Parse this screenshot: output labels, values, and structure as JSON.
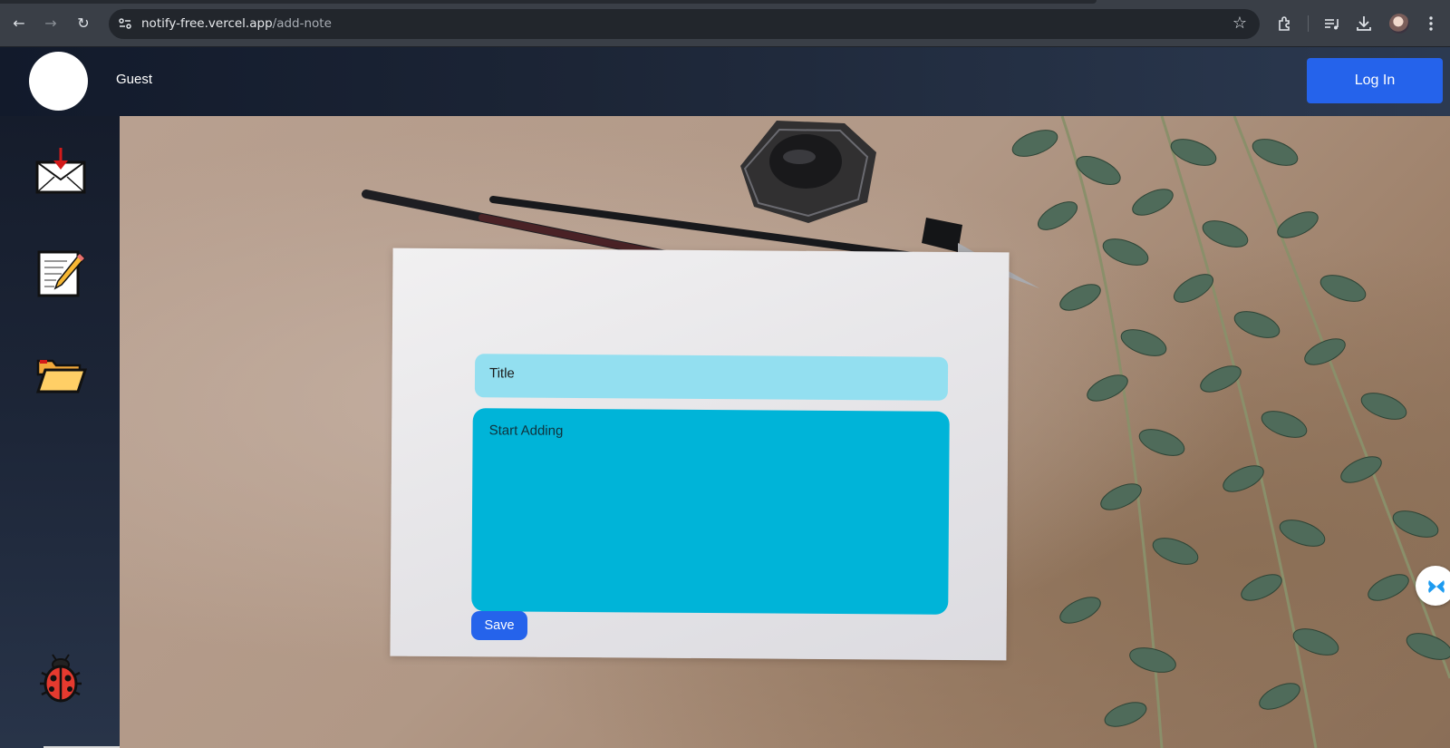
{
  "browser": {
    "url_domain": "notify-free.vercel.app",
    "url_path": "/add-note",
    "icons": [
      "back-icon",
      "forward-icon",
      "reload-icon",
      "site-info-icon",
      "bookmark-star-icon",
      "extensions-icon",
      "media-control-icon",
      "download-icon",
      "profile-avatar",
      "more-menu-icon"
    ]
  },
  "header": {
    "user_name": "Guest",
    "login_label": "Log In"
  },
  "sidebar": {
    "items": [
      {
        "icon": "inbox-envelope-icon"
      },
      {
        "icon": "memo-note-icon"
      },
      {
        "icon": "open-folder-icon"
      },
      {
        "icon": "ladybug-icon"
      }
    ]
  },
  "note_form": {
    "title_placeholder": "Title",
    "body_placeholder": "Start Adding",
    "save_label": "Save"
  },
  "colors": {
    "header_dark": "#121a2b",
    "accent_blue": "#2563eb",
    "title_field": "#93dff0",
    "body_field": "#00b4d8"
  }
}
